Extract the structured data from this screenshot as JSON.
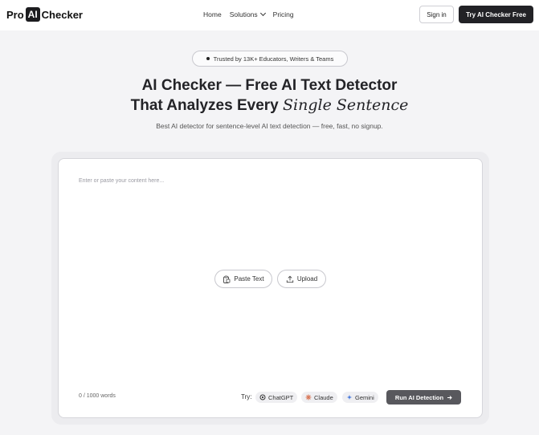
{
  "header": {
    "logo_pre": "Pro",
    "logo_ai": "AI",
    "logo_post": "Checker",
    "nav": [
      {
        "label": "Home"
      },
      {
        "label": "Solutions"
      },
      {
        "label": "Pricing"
      }
    ],
    "signin_label": "Sign in",
    "try_label": "Try AI Checker Free"
  },
  "hero": {
    "badge": "Trusted by 13K+ Educators, Writers & Teams",
    "title_line1": "AI Checker — Free AI Text Detector",
    "title_line2_plain": "That Analyzes Every",
    "title_line2_serif": "Single Sentence",
    "subtitle": "Best AI detector for sentence-level AI text detection — free, fast, no signup."
  },
  "editor": {
    "placeholder": "Enter or paste your content here...",
    "paste_label": "Paste Text",
    "upload_label": "Upload",
    "word_count": "0 / 1000 words",
    "try_label": "Try:",
    "models": [
      {
        "label": "ChatGPT",
        "icon": "openai-icon"
      },
      {
        "label": "Claude",
        "icon": "claude-icon",
        "color": "#d97757"
      },
      {
        "label": "Gemini",
        "icon": "gemini-icon",
        "color": "#4a7bdc"
      }
    ],
    "run_label": "Run AI Detection"
  }
}
